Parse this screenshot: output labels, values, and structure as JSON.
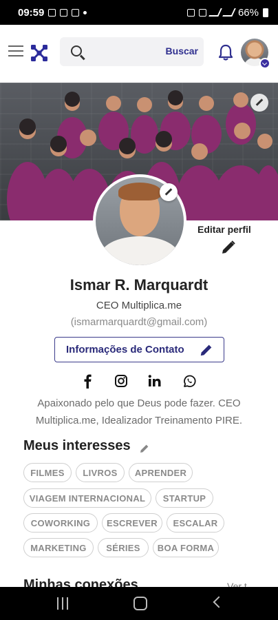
{
  "status_bar": {
    "time": "09:59",
    "battery": "66%"
  },
  "header": {
    "search_placeholder": "",
    "search_button": "Buscar"
  },
  "profile": {
    "edit_profile_label": "Editar perfil",
    "name": "Ismar R. Marquardt",
    "role": "CEO Multiplica.me",
    "email": "(ismarmarquardt@gmail.com)",
    "contact_button": "Informações de Contato",
    "socials": [
      "facebook-icon",
      "instagram-icon",
      "linkedin-icon",
      "whatsapp-icon"
    ],
    "bio": "Apaixonado pelo que Deus pode fazer. CEO Multiplica.me, Idealizador Treinamento PIRE."
  },
  "interests": {
    "title": "Meus interesses",
    "chips": [
      "FILMES",
      "LIVROS",
      "APRENDER",
      "VIAGEM INTERNACIONAL",
      "STARTUP",
      "COWORKING",
      "ESCREVER",
      "ESCALAR",
      "MARKETING",
      "SÉRIES",
      "BOA FORMA"
    ]
  },
  "next_section": {
    "title": "Minhas conexões",
    "link": "Ver t"
  },
  "colors": {
    "accent": "#2f2f8f",
    "cover_shirts": "#8a2c6e",
    "chip_border": "#cfcfcf"
  }
}
